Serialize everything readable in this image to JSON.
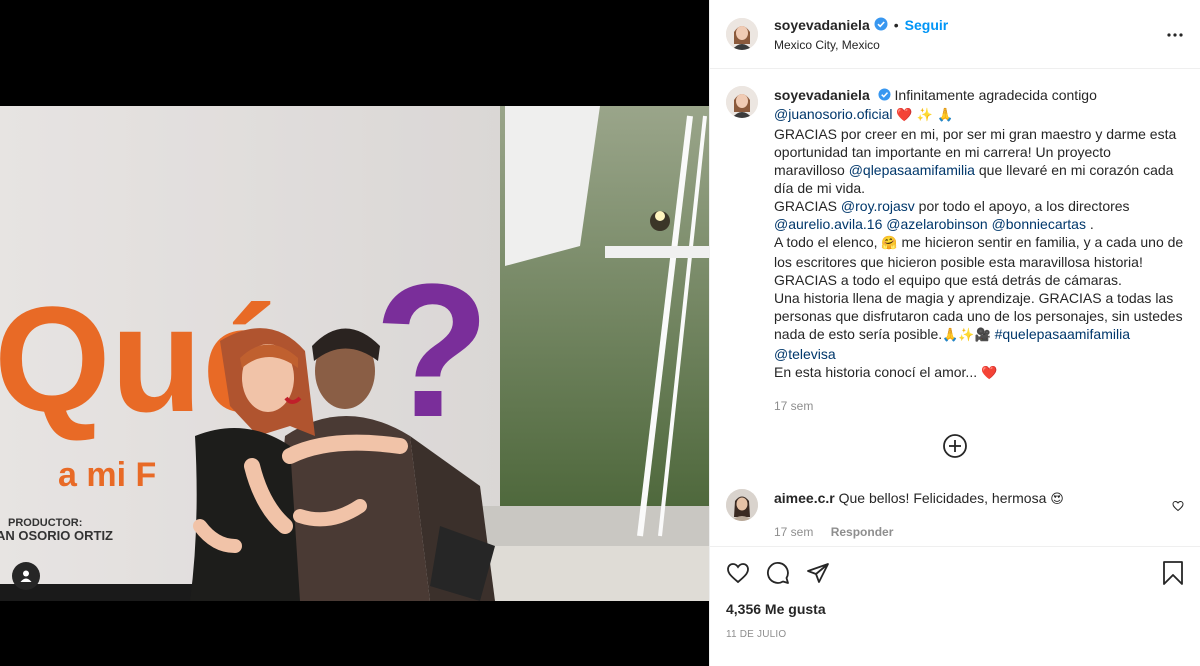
{
  "post": {
    "username": "soyevadaniela",
    "location": "Mexico City, Mexico",
    "follow_label": "Seguir",
    "separator": "•"
  },
  "photo": {
    "banner_word": "Qué",
    "banner_sub": "a mi F",
    "banner_producer_label": "PRODUCTOR:",
    "banner_producer_name": "AN OSORIO ORTIZ",
    "colors": {
      "orange": "#e86a26",
      "purple": "#7a2e9a",
      "wall": "#dcd8d6"
    }
  },
  "caption": {
    "username": "soyevadaniela",
    "text_1": "Infinitamente agradecida contigo",
    "mention_1": "@juanosorio.oficial",
    "emojis_1": "❤️ ✨ 🙏",
    "text_2": "GRACIAS por creer en mi, por ser mi gran maestro y darme esta oportunidad tan importante en mi carrera! Un proyecto maravilloso",
    "mention_2": "@qlepasaamifamilia",
    "text_3": "que llevaré en mi corazón cada día de mi vida.",
    "text_4": "GRACIAS",
    "mention_3": "@roy.rojasv",
    "text_5": "por todo el apoyo, a los directores",
    "mention_4": "@aurelio.avila.16",
    "mention_5": "@azelarobinson",
    "mention_6": "@bonniecartas",
    "text_6": ".",
    "text_7": "A todo el elenco,",
    "emoji_hug": "🤗",
    "text_8": "me hicieron sentir en familia, y a cada uno de los escritores que hicieron posible esta maravillosa historia!",
    "text_9": "GRACIAS a todo el equipo que está detrás de cámaras.",
    "text_10": "Una historia llena de magia y aprendizaje. GRACIAS a todas las personas que disfrutaron cada uno de los personajes, sin ustedes nada de esto sería posible.",
    "emojis_2": "🙏✨🎥",
    "hashtag": "#quelepasaamifamilia",
    "mention_7": "@televisa",
    "text_11": "En esta historia conocí el amor...",
    "emoji_end": "❤️",
    "time": "17 sem"
  },
  "comment": {
    "username": "aimee.c.r",
    "text": "Que bellos! Felicidades, hermosa",
    "emoji": "😍",
    "time": "17 sem",
    "reply_label": "Responder"
  },
  "footer": {
    "likes": "4,356 Me gusta",
    "date": "11 DE JULIO"
  },
  "icons": {
    "verified": "verified-badge-icon",
    "more": "more-options-icon",
    "load_more": "plus-circle-icon",
    "like": "heart-icon",
    "comment": "comment-icon",
    "share": "share-icon",
    "save": "bookmark-icon",
    "user_tag": "user-tag-icon"
  }
}
